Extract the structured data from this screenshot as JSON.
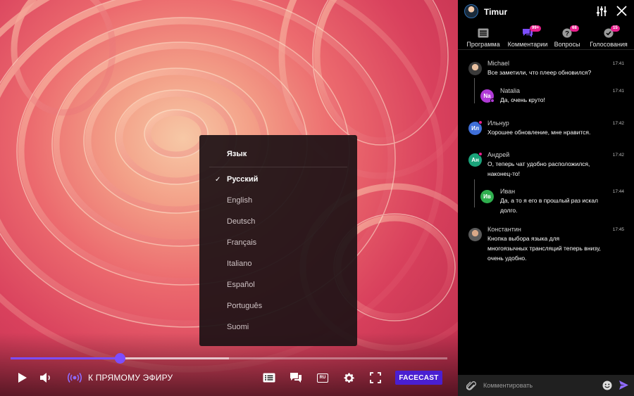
{
  "player": {
    "progress_percent": 25,
    "buffered_percent": 50,
    "live_label": "К ПРЯМОМУ ЭФИРУ",
    "brand_button": "FACECAST",
    "language_badge": "RU",
    "accent_color": "#7c4dff",
    "brand_color": "#4a1fd1"
  },
  "language_menu": {
    "title": "Язык",
    "selected_index": 0,
    "options": [
      "Русский",
      "English",
      "Deutsch",
      "Français",
      "Italiano",
      "Español",
      "Português",
      "Suomi"
    ]
  },
  "sidebar": {
    "user": "Timur",
    "tabs": [
      {
        "label": "Программа",
        "icon": "list-icon",
        "badge": ""
      },
      {
        "label": "Комментарии",
        "icon": "chat-icon",
        "badge": "99+"
      },
      {
        "label": "Вопросы",
        "icon": "question-icon",
        "badge": "68"
      },
      {
        "label": "Голосования",
        "icon": "check-circle-icon",
        "badge": "15"
      }
    ],
    "active_tab": 1,
    "badge_color": "#e91e8c"
  },
  "chat": {
    "messages": [
      {
        "initials": "",
        "name": "Michael",
        "time": "17:41",
        "lines": [
          "Все заметили, что плеер обновился?"
        ],
        "color": "#444444",
        "photo": true
      },
      {
        "initials": "Na",
        "name": "Natalia",
        "time": "17:41",
        "lines": [
          "Да, очень круто!"
        ],
        "color": "#b03ad6",
        "reply": true
      },
      {
        "initials": "Ил",
        "name": "Ильнур",
        "time": "17:42",
        "lines": [
          "Хорошее обновление, мне нравится."
        ],
        "color": "#3f6fd8"
      },
      {
        "initials": "Ан",
        "name": "Андрей",
        "time": "17:42",
        "lines": [
          "О, теперь чат удобно расположился,",
          "наконец-то!"
        ],
        "color": "#1aa37a"
      },
      {
        "initials": "Ив",
        "name": "Иван",
        "time": "17:44",
        "lines": [
          "Да, а то я его в прошлый раз искал",
          "долго."
        ],
        "color": "#2fae4e",
        "reply": true
      },
      {
        "initials": "",
        "name": "Константин",
        "time": "17:45",
        "lines": [
          "Кнопка выбора языка для",
          "многоязычных трансляций теперь внизу,",
          "очень удобно."
        ],
        "color": "#555555",
        "photo": true
      }
    ]
  },
  "input": {
    "placeholder": "Комментировать"
  }
}
